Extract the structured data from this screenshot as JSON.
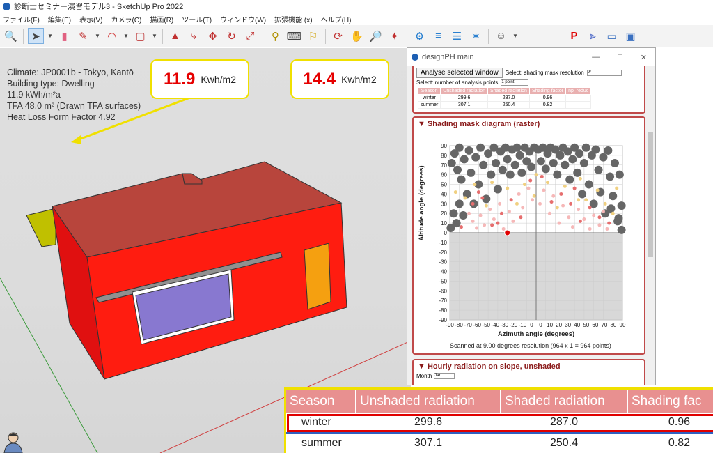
{
  "window": {
    "title": "診断士セミナー演習モデル3 - SketchUp Pro 2022"
  },
  "menu": [
    "ファイル(F)",
    "編集(E)",
    "表示(V)",
    "カメラ(C)",
    "描画(R)",
    "ツール(T)",
    "ウィンドウ(W)",
    "拡張機能 (x)",
    "ヘルプ(H)"
  ],
  "toolbar": {
    "icons": [
      "search-icon",
      "select-arrow-icon",
      "eraser-icon",
      "pencil-icon",
      "arc-icon",
      "rectangle-icon",
      "push-pull-icon",
      "follow-me-icon",
      "move-icon",
      "rotate-icon",
      "scale-icon",
      "tape-measure-icon",
      "text-icon",
      "paint-bucket-icon",
      "orbit-icon",
      "pan-icon",
      "zoom-icon",
      "zoom-extents-icon",
      "component-icon",
      "layers-icon",
      "styles-icon",
      "scenes-icon",
      "account-icon",
      "designph-icon",
      "axes-icon",
      "section-icon",
      "view-icon"
    ]
  },
  "model_info": {
    "climate": "Climate: JP0001b - Tokyo, Kantō",
    "building_type": "Building type: Dwelling",
    "energy": "11.9 kWh/m²a",
    "tfa": "TFA  48.0 m² (Drawn TFA surfaces)",
    "heat_loss": "Heat Loss Form Factor 4.92"
  },
  "callouts": [
    {
      "value": "11.9",
      "unit": "Kwh/m2"
    },
    {
      "value": "14.4",
      "unit": "Kwh/m2"
    }
  ],
  "panel": {
    "title": "designPH main",
    "analyse_button": "Analyse selected window",
    "shading_res_label": "Select: shading mask resolution",
    "shading_res_value": "9°",
    "points_label": "Select: number of analysis points",
    "points_value": "1 point",
    "mini_table": {
      "headers": [
        "Season",
        "Unshaded radiation",
        "Shaded radiation",
        "Shading factor",
        "np_reduc"
      ],
      "rows": [
        [
          "winter",
          "299.6",
          "287.0",
          "0.96",
          ""
        ],
        [
          "summer",
          "307.1",
          "250.4",
          "0.82",
          ""
        ]
      ]
    },
    "mask_section": {
      "title": "Shading mask diagram (raster)",
      "caption": "Scanned at 9.00 degrees resolution (964 x 1 = 964 points)"
    },
    "hourly_section": {
      "title": "Hourly radiation on slope, unshaded",
      "month_label": "Month",
      "month_value": "Jan"
    }
  },
  "chart_data": {
    "type": "scatter",
    "title": "Shading mask diagram (raster)",
    "xlabel": "Azimuth angle (degrees)",
    "ylabel": "Altitude angle (degrees)",
    "xlim": [
      -90,
      90
    ],
    "ylim": [
      -90,
      90
    ],
    "x_ticks": [
      -90,
      -80,
      -70,
      -60,
      -50,
      -40,
      -30,
      -20,
      -10,
      0,
      0,
      10,
      20,
      30,
      40,
      50,
      60,
      70,
      80,
      90
    ],
    "y_ticks": [
      90,
      80,
      70,
      60,
      50,
      40,
      30,
      20,
      10,
      0,
      -10,
      -20,
      -30,
      -40,
      -50,
      -60,
      -70,
      -80,
      -90
    ],
    "x_tick_labels": [
      "-90",
      "-80",
      "-70",
      "-60",
      "-50",
      "-40",
      "-30",
      "-20",
      "-10",
      "0",
      "0",
      "10",
      "20",
      "30",
      "40",
      "50",
      "60",
      "70",
      "80",
      "90"
    ],
    "series": [
      {
        "color": "#666666",
        "points": [
          [
            -88,
            72
          ],
          [
            -85,
            82
          ],
          [
            -82,
            65
          ],
          [
            -80,
            88
          ],
          [
            -78,
            55
          ],
          [
            -75,
            76
          ],
          [
            -72,
            40
          ],
          [
            -70,
            85
          ],
          [
            -68,
            62
          ],
          [
            -65,
            30
          ],
          [
            -63,
            78
          ],
          [
            -60,
            50
          ],
          [
            -58,
            88
          ],
          [
            -55,
            70
          ],
          [
            -52,
            35
          ],
          [
            -50,
            82
          ],
          [
            -47,
            60
          ],
          [
            -44,
            88
          ],
          [
            -42,
            72
          ],
          [
            -40,
            45
          ],
          [
            -37,
            84
          ],
          [
            -35,
            65
          ],
          [
            -32,
            88
          ],
          [
            -30,
            76
          ],
          [
            -27,
            60
          ],
          [
            -25,
            86
          ],
          [
            -22,
            70
          ],
          [
            -20,
            88
          ],
          [
            -17,
            80
          ],
          [
            -15,
            62
          ],
          [
            -12,
            88
          ],
          [
            -10,
            74
          ],
          [
            -7,
            84
          ],
          [
            -5,
            68
          ],
          [
            -2,
            88
          ],
          [
            2,
            86
          ],
          [
            5,
            74
          ],
          [
            7,
            88
          ],
          [
            10,
            66
          ],
          [
            12,
            82
          ],
          [
            15,
            88
          ],
          [
            18,
            72
          ],
          [
            20,
            86
          ],
          [
            22,
            60
          ],
          [
            25,
            80
          ],
          [
            28,
            88
          ],
          [
            30,
            70
          ],
          [
            33,
            84
          ],
          [
            35,
            55
          ],
          [
            38,
            76
          ],
          [
            40,
            88
          ],
          [
            43,
            62
          ],
          [
            45,
            82
          ],
          [
            48,
            40
          ],
          [
            50,
            72
          ],
          [
            52,
            88
          ],
          [
            55,
            50
          ],
          [
            58,
            80
          ],
          [
            60,
            30
          ],
          [
            62,
            86
          ],
          [
            65,
            65
          ],
          [
            67,
            42
          ],
          [
            70,
            78
          ],
          [
            72,
            20
          ],
          [
            75,
            85
          ],
          [
            77,
            58
          ],
          [
            80,
            38
          ],
          [
            82,
            72
          ],
          [
            85,
            12
          ],
          [
            87,
            60
          ],
          [
            89,
            28
          ],
          [
            -89,
            5
          ],
          [
            -86,
            20
          ],
          [
            -83,
            10
          ],
          [
            89,
            3
          ],
          [
            86,
            15
          ],
          [
            -80,
            30
          ],
          [
            -76,
            18
          ],
          [
            78,
            25
          ]
        ]
      },
      {
        "color": "#f6b8b8",
        "points": [
          [
            -70,
            20
          ],
          [
            -66,
            12
          ],
          [
            -62,
            5
          ],
          [
            -58,
            18
          ],
          [
            -54,
            8
          ],
          [
            -48,
            24
          ],
          [
            -44,
            14
          ],
          [
            -38,
            30
          ],
          [
            -34,
            4
          ],
          [
            -28,
            22
          ],
          [
            -24,
            12
          ],
          [
            -18,
            40
          ],
          [
            -14,
            26
          ],
          [
            -8,
            46
          ],
          [
            -4,
            34
          ],
          [
            4,
            30
          ],
          [
            8,
            44
          ],
          [
            14,
            20
          ],
          [
            18,
            38
          ],
          [
            24,
            10
          ],
          [
            28,
            28
          ],
          [
            34,
            16
          ],
          [
            38,
            6
          ],
          [
            44,
            24
          ],
          [
            50,
            14
          ],
          [
            56,
            4
          ],
          [
            60,
            18
          ],
          [
            66,
            8
          ],
          [
            70,
            22
          ],
          [
            74,
            4
          ]
        ]
      },
      {
        "color": "#e66e6e",
        "points": [
          [
            -66,
            30
          ],
          [
            -56,
            36
          ],
          [
            -46,
            8
          ],
          [
            -36,
            20
          ],
          [
            -26,
            34
          ],
          [
            -16,
            16
          ],
          [
            -6,
            54
          ],
          [
            6,
            58
          ],
          [
            16,
            32
          ],
          [
            26,
            40
          ],
          [
            36,
            30
          ],
          [
            46,
            12
          ],
          [
            56,
            26
          ],
          [
            66,
            16
          ],
          [
            76,
            10
          ],
          [
            -78,
            6
          ],
          [
            -60,
            42
          ],
          [
            40,
            46
          ],
          [
            -40,
            10
          ]
        ]
      },
      {
        "color": "#f0d080",
        "points": [
          [
            -74,
            36
          ],
          [
            -52,
            28
          ],
          [
            -30,
            46
          ],
          [
            -12,
            50
          ],
          [
            0,
            60
          ],
          [
            12,
            52
          ],
          [
            30,
            48
          ],
          [
            52,
            34
          ],
          [
            72,
            30
          ],
          [
            -64,
            50
          ],
          [
            64,
            44
          ],
          [
            -2,
            38
          ],
          [
            22,
            26
          ],
          [
            -20,
            30
          ],
          [
            44,
            34
          ],
          [
            80,
            20
          ],
          [
            -84,
            42
          ],
          [
            84,
            46
          ],
          [
            -46,
            52
          ],
          [
            46,
            56
          ]
        ]
      }
    ]
  },
  "zoom_table": {
    "headers": [
      "Season",
      "Unshaded radiation",
      "Shaded radiation",
      "Shading fac"
    ],
    "rows": [
      [
        "winter",
        "299.6",
        "287.0",
        "0.96"
      ],
      [
        "summer",
        "307.1",
        "250.4",
        "0.82"
      ]
    ]
  },
  "colors": {
    "accent_red": "#e60000",
    "callout_border": "#f0e000",
    "section_border": "#c04a4a",
    "wall_red": "#ee1010",
    "roof": "#b8453c",
    "window": "#8878d0",
    "door": "#f5a010"
  }
}
